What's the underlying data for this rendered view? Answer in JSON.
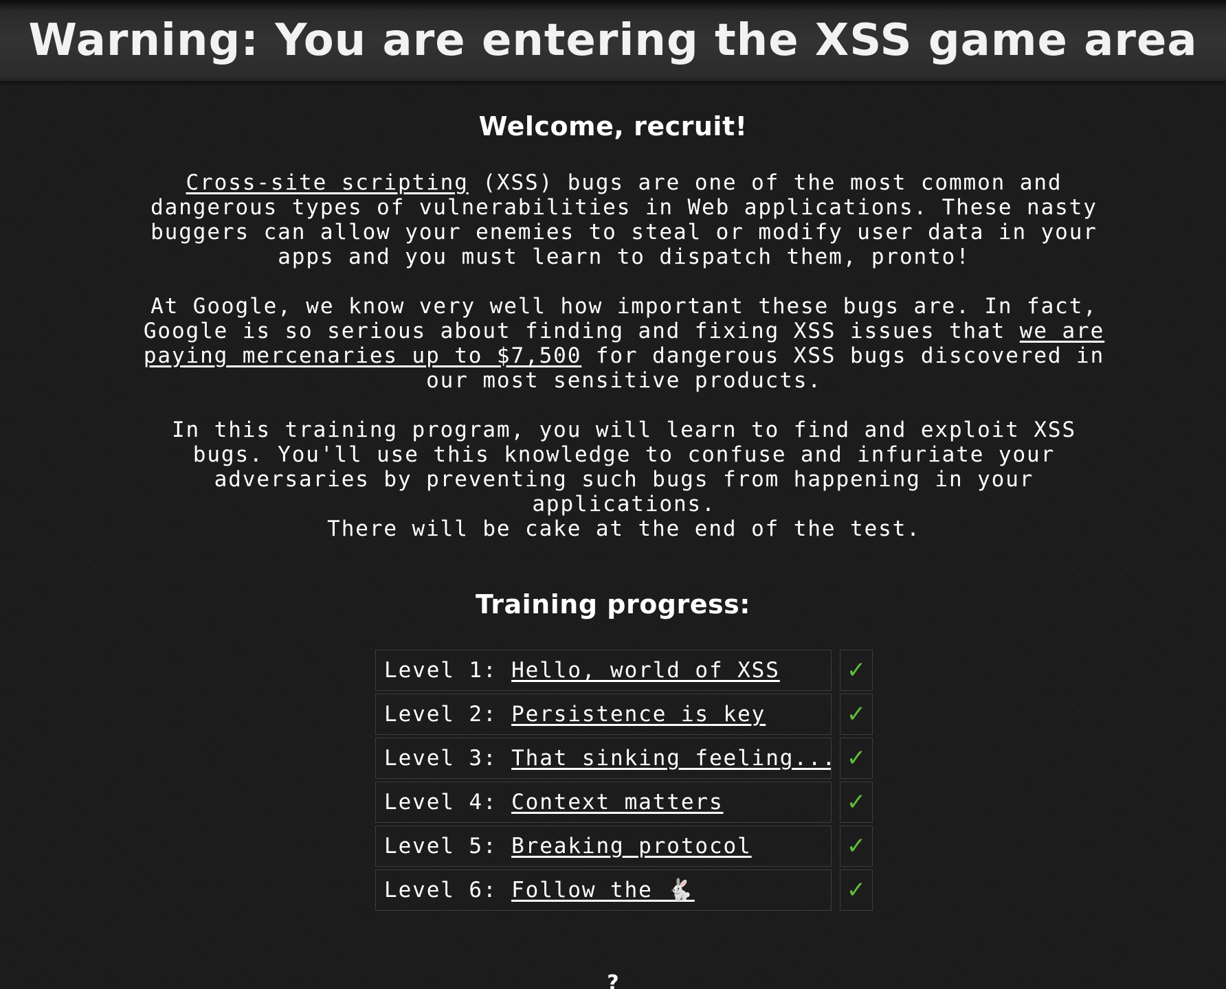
{
  "header": {
    "title": "Warning: You are entering the XSS game area"
  },
  "welcome": {
    "heading": "Welcome, recruit!"
  },
  "intro": {
    "p1_link": "Cross-site scripting",
    "p1_text": " (XSS) bugs are one of the most common and dangerous types of vulnerabilities in Web applications. These nasty buggers can allow your enemies to steal or modify user data in your apps and you must learn to dispatch them, pronto!",
    "p2_text_a": "At Google, we know very well how important these bugs are. In fact, Google is so serious about finding and fixing XSS issues that ",
    "p2_link": "we are paying mercenaries up to $7,500",
    "p2_text_b": " for dangerous XSS bugs discovered in our most sensitive products.",
    "p3_text": "In this training program, you will learn to find and exploit XSS bugs. You'll use this knowledge to confuse and infuriate your adversaries by preventing such bugs from happening in your applications.",
    "p4_text": "There will be cake at the end of the test."
  },
  "progress": {
    "heading": "Training progress:",
    "levels": [
      {
        "prefix": "Level 1: ",
        "title": "Hello, world of XSS",
        "status": "✓"
      },
      {
        "prefix": "Level 2: ",
        "title": "Persistence is key",
        "status": "✓"
      },
      {
        "prefix": "Level 3: ",
        "title": "That sinking feeling...",
        "status": "✓"
      },
      {
        "prefix": "Level 4: ",
        "title": "Context matters",
        "status": "✓"
      },
      {
        "prefix": "Level 5: ",
        "title": "Breaking protocol",
        "status": "✓"
      },
      {
        "prefix": "Level 6: ",
        "title": "Follow the 🐇",
        "status": "✓"
      }
    ]
  },
  "footer": {
    "mark": "?"
  },
  "colors": {
    "check": "#5fbd3c",
    "background": "#1c1c1c",
    "header": "#333333"
  }
}
